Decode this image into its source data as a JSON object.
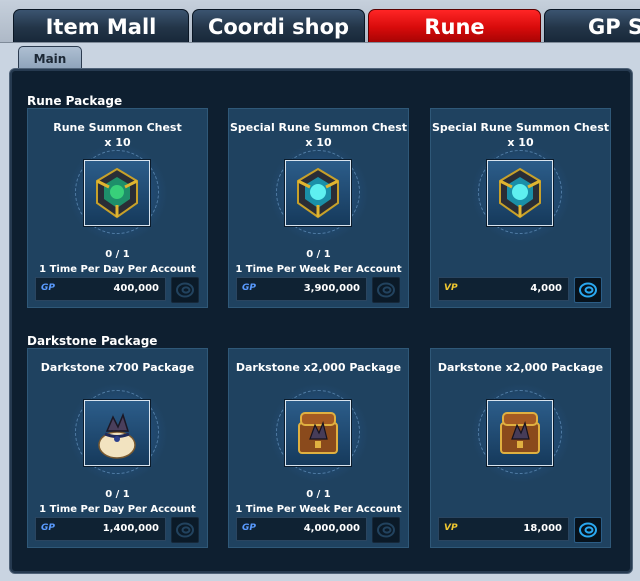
{
  "tabs": [
    {
      "label": "Item Mall",
      "active": false
    },
    {
      "label": "Coordi shop",
      "active": false
    },
    {
      "label": "Rune",
      "active": true
    },
    {
      "label": "GP Sh",
      "active": false
    }
  ],
  "sub_tab": {
    "label": "Main"
  },
  "sections": [
    {
      "title": "Rune Package",
      "cards": [
        {
          "title_line1": "Rune Summon Chest",
          "title_line2": "x 10",
          "icon": "rune-chest-icon",
          "limit_count": "0 / 1",
          "limit_text": "1 Time Per Day Per Account",
          "currency": "GP",
          "price": "400,000",
          "buy_enabled": false
        },
        {
          "title_line1": "Special Rune Summon Chest",
          "title_line2": "x 10",
          "icon": "special-rune-chest-icon",
          "limit_count": "0 / 1",
          "limit_text": "1 Time Per Week Per Account",
          "currency": "GP",
          "price": "3,900,000",
          "buy_enabled": false
        },
        {
          "title_line1": "Special Rune Summon Chest",
          "title_line2": "x 10",
          "icon": "special-rune-chest-icon",
          "limit_count": "",
          "limit_text": "",
          "currency": "VP",
          "price": "4,000",
          "buy_enabled": true
        }
      ]
    },
    {
      "title": "Darkstone Package",
      "cards": [
        {
          "title_line1": "Darkstone x700 Package",
          "title_line2": "",
          "icon": "darkstone-bag-icon",
          "limit_count": "0 / 1",
          "limit_text": "1 Time Per Day Per Account",
          "currency": "GP",
          "price": "1,400,000",
          "buy_enabled": false
        },
        {
          "title_line1": "Darkstone x2,000 Package",
          "title_line2": "",
          "icon": "darkstone-chest-icon",
          "limit_count": "0 / 1",
          "limit_text": "1 Time Per Week Per Account",
          "currency": "GP",
          "price": "4,000,000",
          "buy_enabled": false
        },
        {
          "title_line1": "Darkstone x2,000 Package",
          "title_line2": "",
          "icon": "darkstone-chest-icon",
          "limit_count": "",
          "limit_text": "",
          "currency": "VP",
          "price": "18,000",
          "buy_enabled": true
        }
      ]
    }
  ],
  "colors": {
    "active_tab": "#d70b0b",
    "panel_bg": "#0e1f30",
    "card_bg": "#1f4260",
    "gp": "#5a9bff",
    "vp": "#f0c830"
  }
}
